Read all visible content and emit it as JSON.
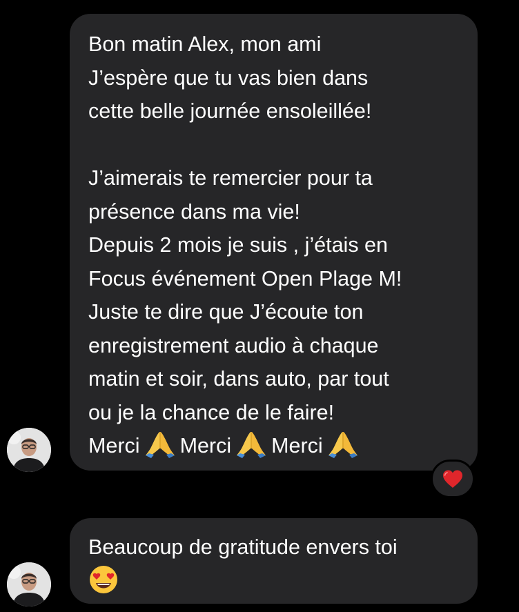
{
  "messages": [
    {
      "lines": [
        "Bon matin Alex, mon ami",
        "J’espère que tu vas bien dans",
        "cette belle journée ensoleillée!",
        "",
        "J’aimerais te remercier pour ta",
        "présence dans ma vie!",
        "Depuis 2 mois je suis , j’étais en",
        "Focus événement Open Plage M!",
        "Juste te dire que J’écoute ton",
        "enregistrement audio à chaque",
        "matin et soir, dans auto, par tout",
        "ou je la chance de le faire!"
      ],
      "last_line_words": [
        "Merci",
        "Merci",
        "Merci"
      ],
      "last_line_icon": "folded-hands-emoji",
      "reaction": "red-heart-emoji"
    },
    {
      "lines": [
        "Beaucoup de gratitude envers toi"
      ],
      "trailing_icon": "heart-eyes-emoji"
    }
  ],
  "colors": {
    "background": "#000000",
    "bubble": "#262628",
    "text": "#ffffff",
    "heart": "#e0262b"
  }
}
